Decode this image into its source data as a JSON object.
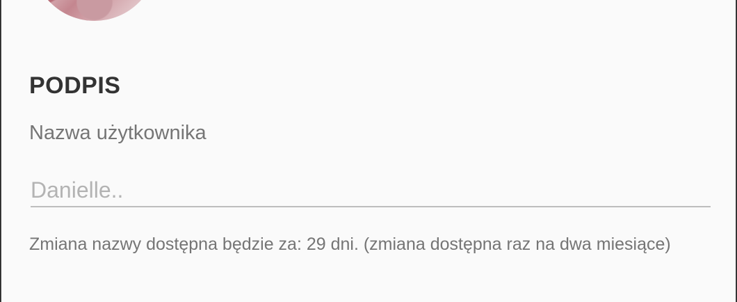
{
  "profile": {
    "avatar_alt": "avatar"
  },
  "signature": {
    "title": "PODPIS",
    "username_label": "Nazwa użytkownika",
    "username_placeholder": "Danielle..",
    "username_value": "",
    "helper_text": "Zmiana nazwy dostępna będzie za: 29 dni. (zmiana dostępna raz na dwa miesiące)"
  },
  "colors": {
    "background": "#fafafa",
    "title": "#333333",
    "secondary_text": "#757575",
    "placeholder": "#b3b3b3",
    "underline": "#bdbdbd"
  }
}
